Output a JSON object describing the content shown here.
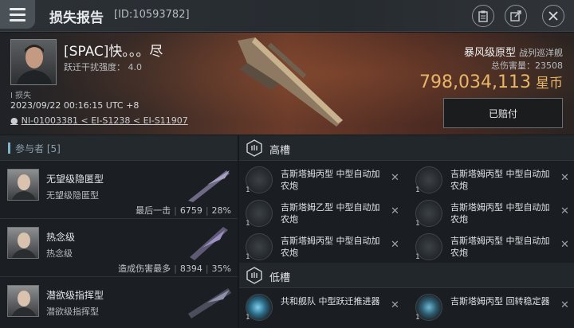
{
  "header": {
    "title": "损失报告",
    "kill_id": "[ID:10593782]",
    "menu_icon": "hamburger-menu-icon",
    "icons": [
      "clipboard-icon",
      "share-icon",
      "close-icon"
    ]
  },
  "victim": {
    "pilot_name": "[SPAC]快。。。尽",
    "warp_label": "跃迁干扰强度：",
    "warp_value": "4.0",
    "lost_tag": "I 损失",
    "datetime": "2023/09/22 00:16:15 UTC +8",
    "location": "NI-01003381 < EI-S1238 < EI-S11907",
    "ship_name": "暴风级原型",
    "ship_class": "战列巡洋舰",
    "damage_label": "总伤害量：",
    "damage_value": "23508",
    "isk_value": "798,034,113",
    "isk_unit": "星币",
    "paid_button": "已赔付"
  },
  "attackers": {
    "header": "参与者 [5]",
    "items": [
      {
        "ship": "无望级隐匿型",
        "sub": "无望级隐匿型",
        "tag": "最后一击",
        "damage": "6759",
        "percent": "28%"
      },
      {
        "ship": "热念级",
        "sub": "热念级",
        "tag": "造成伤害最多",
        "damage": "8394",
        "percent": "35%"
      },
      {
        "ship": "潜欲级指挥型",
        "sub": "潜欲级指挥型",
        "tag": "",
        "damage": "",
        "percent": ""
      }
    ]
  },
  "fitting": {
    "high_slots_label": "高槽",
    "low_slots_label": "低槽",
    "high": [
      {
        "name": "吉斯塔姆丙型 中型自动加农炮",
        "qty": "1"
      },
      {
        "name": "吉斯塔姆丙型 中型自动加农炮",
        "qty": "1"
      },
      {
        "name": "吉斯塔姆乙型 中型自动加农炮",
        "qty": "1"
      },
      {
        "name": "吉斯塔姆丙型 中型自动加农炮",
        "qty": "1"
      },
      {
        "name": "吉斯塔姆丙型 中型自动加农炮",
        "qty": "1"
      },
      {
        "name": "吉斯塔姆丙型 中型自动加农炮",
        "qty": "1"
      }
    ],
    "low": [
      {
        "name": "共和舰队 中型跃迁推进器",
        "qty": "1"
      },
      {
        "name": "吉斯塔姆丙型 回转稳定器",
        "qty": "1"
      }
    ],
    "remove_glyph": "✕"
  },
  "colors": {
    "accent": "#e8b668",
    "banner": "#6b3b2a",
    "panel": "#1b1f23"
  }
}
